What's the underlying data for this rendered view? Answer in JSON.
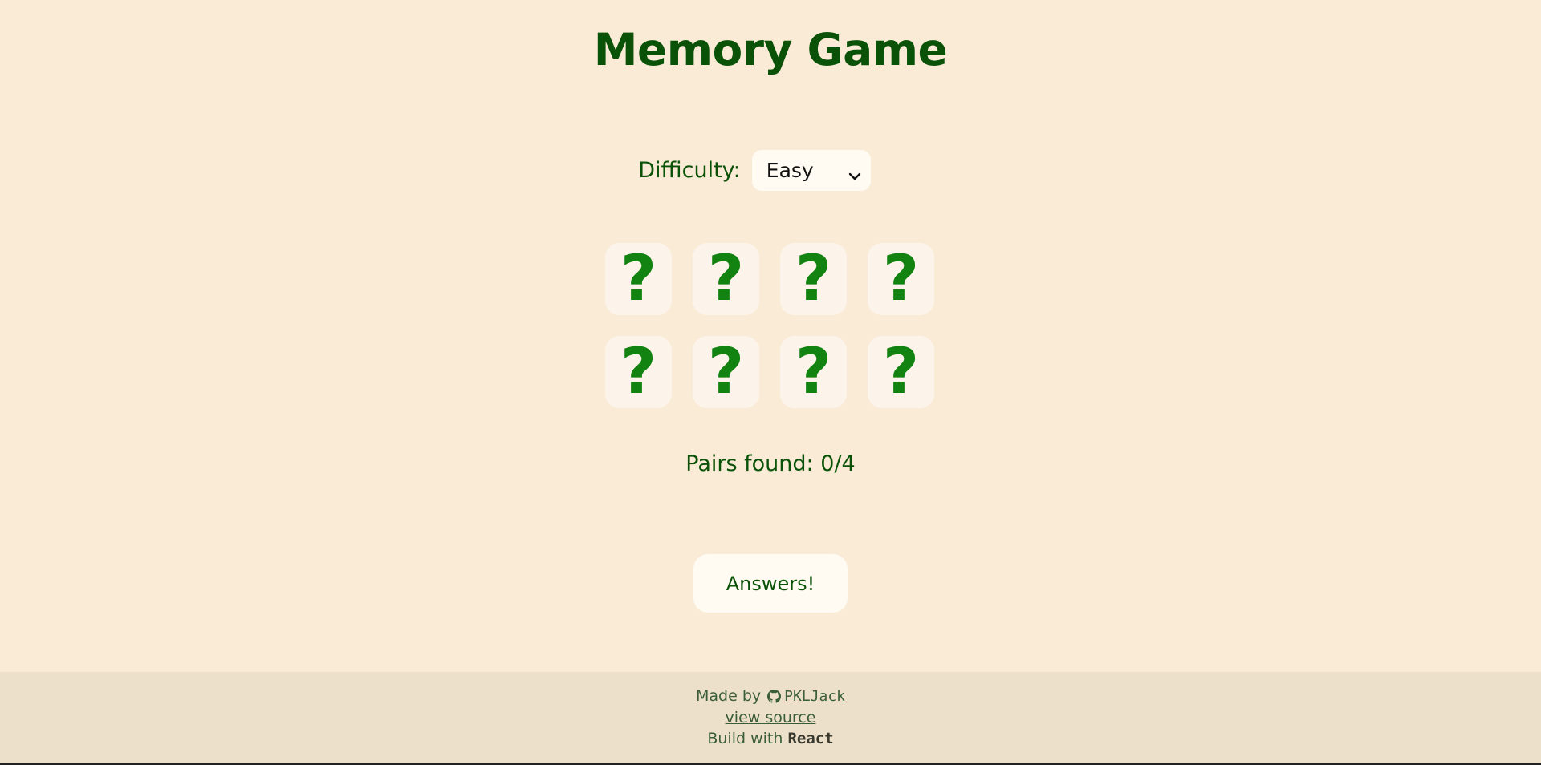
{
  "title": "Memory Game",
  "difficulty": {
    "label": "Difficulty:",
    "selected": "Easy",
    "icon": "chevron-down-icon"
  },
  "board": {
    "cards": [
      "?",
      "?",
      "?",
      "?",
      "?",
      "?",
      "?",
      "?"
    ]
  },
  "status": {
    "pairs_found": "Pairs found: 0/4"
  },
  "answers_button": {
    "label": "Answers!"
  },
  "footer": {
    "made_by_prefix": "Made by",
    "author_icon": "github-icon",
    "author": "PKLJack",
    "source_link": "view source",
    "build_prefix": "Build with",
    "build_tech": "React"
  },
  "colors": {
    "background": "#faebd7",
    "footer_background": "#ede0cb",
    "card_background": "#fcf4ea",
    "title_green": "#0a5208",
    "card_symbol_green": "#128210"
  }
}
